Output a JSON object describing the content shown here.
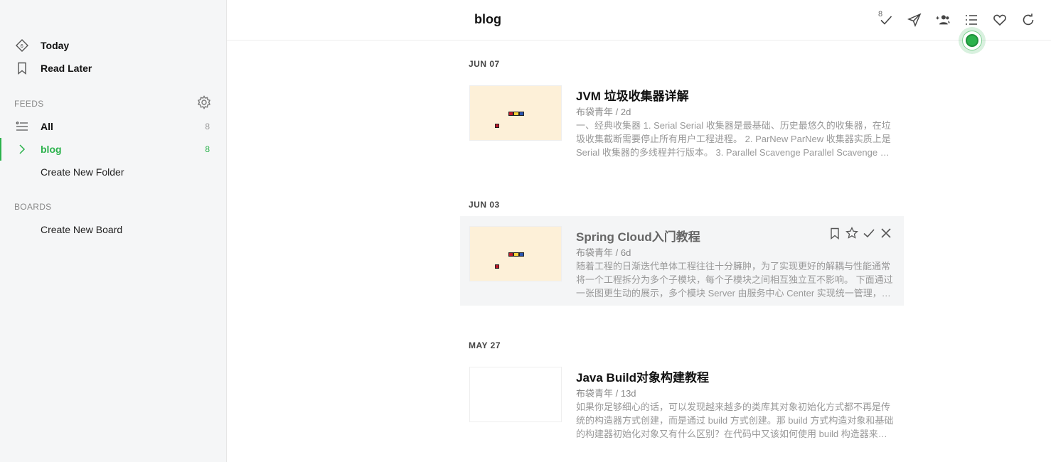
{
  "sidebar": {
    "today_label": "Today",
    "read_later_label": "Read Later",
    "feeds_heading": "FEEDS",
    "feeds": [
      {
        "label": "All",
        "count": "8"
      },
      {
        "label": "blog",
        "count": "8"
      }
    ],
    "create_folder_label": "Create New Folder",
    "boards_heading": "BOARDS",
    "create_board_label": "Create New Board"
  },
  "header": {
    "title": "blog",
    "mark_read_badge": "8",
    "icons": [
      "check-icon",
      "send-icon",
      "follow-people-icon",
      "list-view-icon",
      "heart-icon",
      "refresh-icon"
    ]
  },
  "colors": {
    "accent": "#2bb24c",
    "thumb_bg": "#fdf0d8"
  },
  "articles": [
    {
      "date": "JUN 07",
      "title": "JVM 垃圾收集器详解",
      "meta": "布袋青年 / 2d",
      "summary": "一、经典收集器 1. Serial Serial 收集器是最基础、历史最悠久的收集器，在垃圾收集截断需要停止所有用户工程进程。 2. ParNew ParNew 收集器实质上是 Serial 收集器的多线程并行版本。 3. Parallel Scavenge Parallel Scavenge 收集器的目标是达到一个可控制的吞吐量。"
    },
    {
      "date": "JUN 03",
      "title": "Spring Cloud入门教程",
      "meta": "布袋青年 / 6d",
      "summary": "随着工程的日渐迭代单体工程往往十分臃肿，为了实现更好的解耦与性能通常将一个工程拆分为多个子模块，每个子模块之间相互独立互不影响。 下面通过一张图更生动的展示，多个模块 Server 由服务中心 Center 实现统一管理，并对外提供服务。"
    },
    {
      "date": "MAY 27",
      "title": "Java Build对象构建教程",
      "meta": "布袋青年 / 13d",
      "summary": "如果你足够细心的话，可以发现越来越多的类库其对象初始化方式都不再是传统的构造器方式创建，而是通过 build 方式创建。那 build 方式构造对象和基础的构建器初始化对象又有什么区别？在代码中又该如何使用 build 构造器来创建对象呢？"
    }
  ]
}
